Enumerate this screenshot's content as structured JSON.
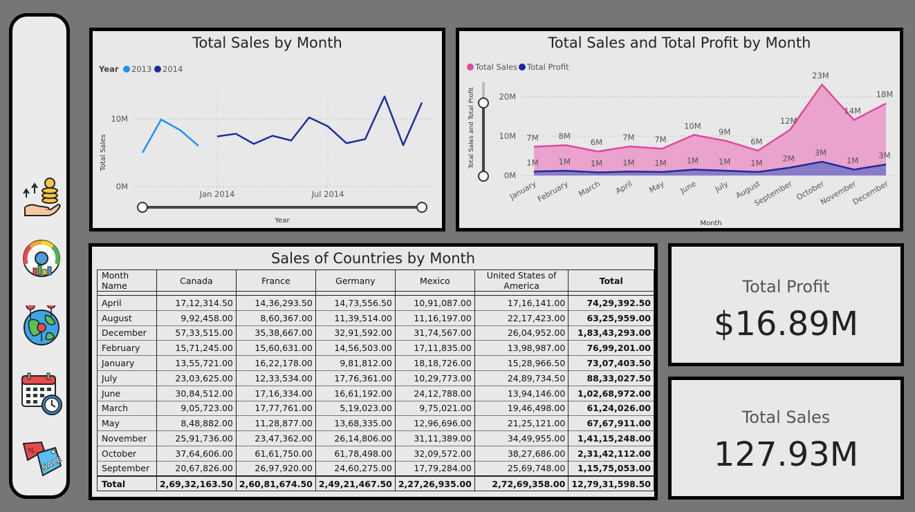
{
  "sidebar": {
    "icons": [
      "money-growth-icon",
      "dashboard-gauge-icon",
      "globe-map-icon",
      "calendar-clock-icon",
      "sale-tag-icon"
    ]
  },
  "chart1": {
    "title": "Total Sales by Month",
    "legend_title": "Year",
    "colors": {
      "2013": "#1e90ff",
      "2014": "#1a2ea0"
    },
    "chart_data": {
      "type": "line",
      "title": "Total Sales by Month",
      "xlabel": "Year",
      "ylabel": "Total Sales",
      "ylim": [
        0,
        14
      ],
      "yticks": [
        "0M",
        "10M"
      ],
      "xticks": [
        "Jan 2014",
        "Jul 2014"
      ],
      "series": [
        {
          "name": "2013",
          "x": [
            "2013-09",
            "2013-10",
            "2013-11",
            "2013-12"
          ],
          "values": [
            5.0,
            9.9,
            8.3,
            6.0
          ]
        },
        {
          "name": "2014",
          "x": [
            "2014-01",
            "2014-02",
            "2014-03",
            "2014-04",
            "2014-05",
            "2014-06",
            "2014-07",
            "2014-08",
            "2014-09",
            "2014-10",
            "2014-11",
            "2014-12"
          ],
          "values": [
            7.4,
            7.8,
            6.3,
            7.5,
            6.8,
            10.2,
            8.9,
            6.4,
            7.0,
            13.3,
            6.1,
            12.4
          ]
        }
      ]
    }
  },
  "chart2": {
    "title": "Total Sales and Total Profit by Month",
    "colors": {
      "sales": "#e0489e",
      "sales_fill": "#e9a3cc",
      "profit": "#1a2a9a",
      "profit_fill": "#8a7bc8"
    },
    "chart_data": {
      "type": "area",
      "title": "Total Sales and Total Profit by Month",
      "xlabel": "Month",
      "ylabel": "Total Sales and Total Profit",
      "ylim": [
        0,
        24
      ],
      "yticks": [
        "0M",
        "10M",
        "20M"
      ],
      "categories": [
        "January",
        "February",
        "March",
        "April",
        "May",
        "June",
        "July",
        "August",
        "September",
        "October",
        "November",
        "December"
      ],
      "series": [
        {
          "name": "Total Sales",
          "values": [
            7.3,
            7.7,
            6.1,
            7.4,
            6.8,
            10.3,
            8.8,
            6.3,
            11.6,
            23.1,
            14.1,
            18.3
          ],
          "labels": [
            "7M",
            "8M",
            "6M",
            "7M",
            "7M",
            "10M",
            "9M",
            "6M",
            "12M",
            "23M",
            "14M",
            "18M"
          ]
        },
        {
          "name": "Total Profit",
          "values": [
            1.0,
            1.2,
            0.8,
            1.0,
            0.9,
            1.5,
            1.2,
            0.9,
            2.0,
            3.5,
            1.5,
            2.8
          ],
          "labels": [
            "1M",
            "1M",
            "1M",
            "1M",
            "1M",
            "1M",
            "1M",
            "1M",
            "2M",
            "3M",
            "1M",
            "3M"
          ]
        }
      ]
    }
  },
  "table": {
    "title": "Sales of Countries by Month",
    "headers": [
      "Month Name",
      "Canada",
      "France",
      "Germany",
      "Mexico",
      "United States of America",
      "Total"
    ],
    "rows": [
      [
        "April",
        "17,12,314.50",
        "14,36,293.50",
        "14,73,556.50",
        "10,91,087.00",
        "17,16,141.00",
        "74,29,392.50"
      ],
      [
        "August",
        "9,92,458.00",
        "8,60,367.00",
        "11,39,514.00",
        "11,16,197.00",
        "22,17,423.00",
        "63,25,959.00"
      ],
      [
        "December",
        "57,33,515.00",
        "35,38,667.00",
        "32,91,592.00",
        "31,74,567.00",
        "26,04,952.00",
        "1,83,43,293.00"
      ],
      [
        "February",
        "15,71,245.00",
        "15,60,631.00",
        "14,56,503.00",
        "17,11,835.00",
        "13,98,987.00",
        "76,99,201.00"
      ],
      [
        "January",
        "13,55,721.00",
        "16,22,178.00",
        "9,81,812.00",
        "18,18,726.00",
        "15,28,966.50",
        "73,07,403.50"
      ],
      [
        "July",
        "23,03,625.00",
        "12,33,534.00",
        "17,76,361.00",
        "10,29,773.00",
        "24,89,734.50",
        "88,33,027.50"
      ],
      [
        "June",
        "30,84,512.00",
        "17,16,334.00",
        "16,61,192.00",
        "24,12,788.00",
        "13,94,146.00",
        "1,02,68,972.00"
      ],
      [
        "March",
        "9,05,723.00",
        "17,77,761.00",
        "5,19,023.00",
        "9,75,021.00",
        "19,46,498.00",
        "61,24,026.00"
      ],
      [
        "May",
        "8,48,882.00",
        "11,28,877.00",
        "13,68,335.00",
        "12,96,696.00",
        "21,25,121.00",
        "67,67,911.00"
      ],
      [
        "November",
        "25,91,736.00",
        "23,47,362.00",
        "26,14,806.00",
        "31,11,389.00",
        "34,49,955.00",
        "1,41,15,248.00"
      ],
      [
        "October",
        "37,64,606.00",
        "61,61,750.00",
        "61,78,498.00",
        "32,09,572.00",
        "38,27,686.00",
        "2,31,42,112.00"
      ],
      [
        "September",
        "20,67,826.00",
        "26,97,920.00",
        "24,60,275.00",
        "17,79,284.00",
        "25,69,748.00",
        "1,15,75,053.00"
      ]
    ],
    "total": [
      "Total",
      "2,69,32,163.50",
      "2,60,81,674.50",
      "2,49,21,467.50",
      "2,27,26,935.00",
      "2,72,69,358.00",
      "12,79,31,598.50"
    ]
  },
  "kpi_profit": {
    "label": "Total Profit",
    "value": "$16.89M"
  },
  "kpi_sales": {
    "label": "Total Sales",
    "value": "127.93M"
  }
}
